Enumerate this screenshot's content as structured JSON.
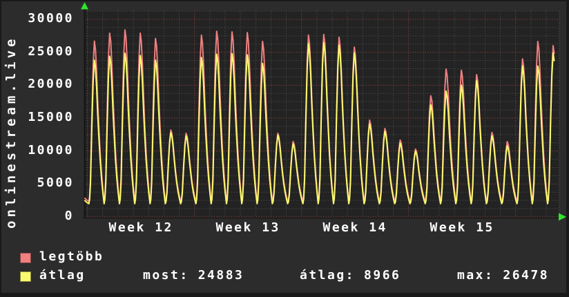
{
  "window": {
    "background": "#2c2c2c",
    "plot_background": "#232323",
    "frame_color": "#191919",
    "text_color": "#ffffff"
  },
  "vertical_title": "onlinestream.live",
  "legend": {
    "max_label": "legtöbb",
    "max_color": "#f08080",
    "avg_label": "átlag",
    "avg_color": "#fafa70"
  },
  "stats": {
    "current_label": "most:",
    "current_value": "24883",
    "average_label": "átlag:",
    "average_value": "8966",
    "max_label": "max:",
    "max_value": "26478"
  },
  "chart_data": {
    "type": "line",
    "title": "onlinestream.live",
    "ylabel": "",
    "xlabel": "",
    "ylim": [
      0,
      31400
    ],
    "y_ticks": [
      0,
      5000,
      10000,
      15000,
      20000,
      25000,
      30000
    ],
    "y_minor_step": 1250,
    "x_tick_labels": [
      "Week 12",
      "Week 13",
      "Week 14",
      "Week 15"
    ],
    "x_major_unit": "week",
    "x_minor_unit": "day",
    "days_shown": 31,
    "grid": {
      "minor_color": "#4f4f4f",
      "major_color": "#9a4343",
      "border_color": "#5c5c5c",
      "axis_color": "#151515",
      "arrow_color": "#2ee52e",
      "style": "dotted"
    },
    "legend_position": "bottom",
    "first_day_index": -1,
    "peak_time_of_day": 0.45,
    "ends_at_last_peak": true,
    "day_profile": [
      [
        -0.36,
        0.0
      ],
      [
        -0.31,
        0.03
      ],
      [
        -0.25,
        0.15
      ],
      [
        -0.16,
        0.55
      ],
      [
        -0.08,
        0.85
      ],
      [
        0.0,
        1.0
      ],
      [
        0.07,
        0.95
      ],
      [
        0.14,
        0.82
      ],
      [
        0.22,
        0.62
      ],
      [
        0.3,
        0.45
      ],
      [
        0.38,
        0.3
      ],
      [
        0.47,
        0.17
      ],
      [
        0.56,
        0.07
      ],
      [
        0.64,
        0.0
      ]
    ],
    "series": [
      {
        "name": "legtöbb",
        "color": "#f08080",
        "low": 2350,
        "daily_peaks": [
          4000,
          26700,
          27900,
          28400,
          27900,
          27100,
          13200,
          12700,
          27600,
          28200,
          28100,
          28000,
          26650,
          12700,
          11450,
          27620,
          27700,
          27280,
          25780,
          14700,
          13430,
          11680,
          10300,
          18400,
          22450,
          22270,
          21600,
          12830,
          11430,
          24000,
          26640,
          26000
        ]
      },
      {
        "name": "átlag",
        "color": "#fafa70",
        "low": 2000,
        "daily_peaks": [
          3600,
          23800,
          24400,
          24850,
          24500,
          23800,
          12800,
          12300,
          24200,
          24700,
          24800,
          24600,
          23300,
          12400,
          11100,
          26300,
          26470,
          26100,
          24900,
          14100,
          13000,
          11200,
          10000,
          17000,
          19100,
          20000,
          20700,
          12300,
          10800,
          22900,
          22900,
          24883
        ]
      }
    ]
  }
}
